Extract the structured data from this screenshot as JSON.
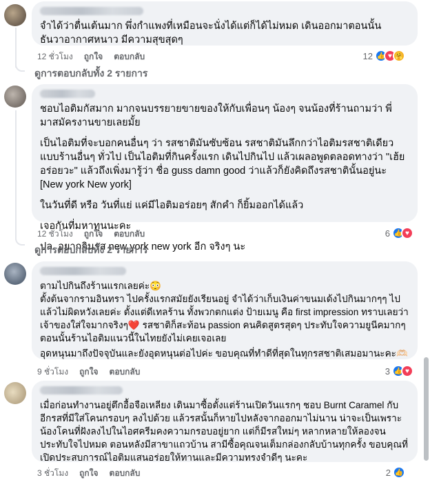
{
  "comments": [
    {
      "text": "จำได้ว่าตื่นเต้นมาก พึ่งกำแพงที่เหมือนจะนั่งได้แต่ก็ได้ไม่หมด เดินออกมาตอนนั้นธันวาอากาศหนาว มีความสุขสุดๆ",
      "time": "12 ชั่วโมง",
      "like": "ถูกใจ",
      "reply": "ตอบกลับ",
      "reaction_count": "12",
      "view_replies": "ดูการตอบกลับทั้ง 2 รายการ"
    },
    {
      "paragraphs": [
        "ชอบไอติมกัสมาก มากจนบรรยายขายของให้กับเพื่อนๆ น้องๆ จนน้องที่ร้านถามว่า พี่มาสมัครงานขายเลยมั้ย",
        "เป็นไอติมที่จะบอกคนอื่นๆ ว่า รสชาติมันซับซ้อน รสชาติมันลึกกว่าไอติมรสชาติเดียวแบบร้านอื่นๆ ทั่วไป เป็นไอติมที่กินครั้งแรก เดินไปกินไป แล้วเผลอพูดตลอดทางว่า \"เฮ้ย อร่อยวะ\" แล้วถึงเพิ่งมารู้ว่า ชื่อ guss damn good ว่าแล้วก็ยังคิดถึงรสชาตินั้นอยู่นะ [New york New york]",
        "ในวันที่ดี หรือ วันที่แย่ แค่มีไอติมอร่อยๆ สักคำ ก็ยิ้มออกได้แล้ว",
        "เจอกันที่มหาทุนนะคะ",
        "ปล. อยากกินรส new york new york อีก จริงๆ นะ"
      ],
      "time": "12 ชั่วโมง",
      "like": "ถูกใจ",
      "reply": "ตอบกลับ",
      "reaction_count": "6",
      "view_replies": "ดูการตอบกลับทั้ง 2 รายการ"
    },
    {
      "paragraphs": [
        "ตามไปกินถึงร้านแรกเลยค่ะ😳",
        "ตั้งต้นจากรามอินทรา ไปครั้งแรกสมัยยังเรียนอยู่ จำได้ว่าเก็บเงินค่าขนมเด้งไปกินมากๆๆ ไปแล้วไม่ผิดหวังเลยค่ะ ตั้งแต่ดีเทลร้าน ทั้งพวกตกแต่ง ป้ายเมนู คือ first impression ทราบเลยว่าเจ้าของใส่ใจมากจริงๆ❤️ รสชาติก็สะท้อน passion คนคิดสูตรสุดๆ ประทับใจความยูนีคมากๆ ตอนนั้นร้านไอติมแนวนี้ในไทยยังไม่เคยเจอเลย",
        "อุดหนุนมาถึงปัจจุบันและยังอุดหนุนต่อไปค่ะ ขอบคุณที่ทำดีที่สุดในทุกรสชาติเสมอมานะคะ🫶🏻"
      ],
      "time": "9 ชั่วโมง",
      "like": "ถูกใจ",
      "reply": "ตอบกลับ",
      "reaction_count": "3"
    },
    {
      "text": "เมื่อก่อนทำงานอยู่ตึกอื้อจือเหลียง เดินมาซื้อตั้งแต่ร้านเปิดวันแรกๆ ชอบ Burnt Caramel กับอีกรสที่มีใส่โคนกรอบๆ ลงไปด้วย แล้วรสนั้นก็หายไปหลังจากออกมาไม่นาน น่าจะเป็นเพราะน้องโคนที่ฝังลงไปในไอศครีมคงความกรอบอยู่ยาก แต่ก็มีรสใหม่ๆ หลากหลายให้ลองจนประทับใจไปหมด ตอนหลังมีสาขาแถวบ้าน สามีซื้อคุณจนเต็มกล่องกลับบ้านทุกครั้ง ขอบคุณที่เปิดประสบการณ์ไอติมแสนอร่อยให้ทานและมีความทรงจำดีๆ นะคะ",
      "time": "3 ชั่วโมง",
      "like": "ถูกใจ",
      "reply": "ตอบกลับ",
      "reaction_count": "2"
    }
  ],
  "icons": {
    "like": "thumbs-up-icon",
    "love": "heart-icon",
    "care": "care-icon",
    "reply_arrow": "corner-down-right-icon"
  },
  "colors": {
    "bubble": "#f0f2f5",
    "meta_text": "#65676b",
    "like_blue": "#1877f2",
    "love_red": "#f33e58",
    "care_yellow": "#f7b125"
  }
}
